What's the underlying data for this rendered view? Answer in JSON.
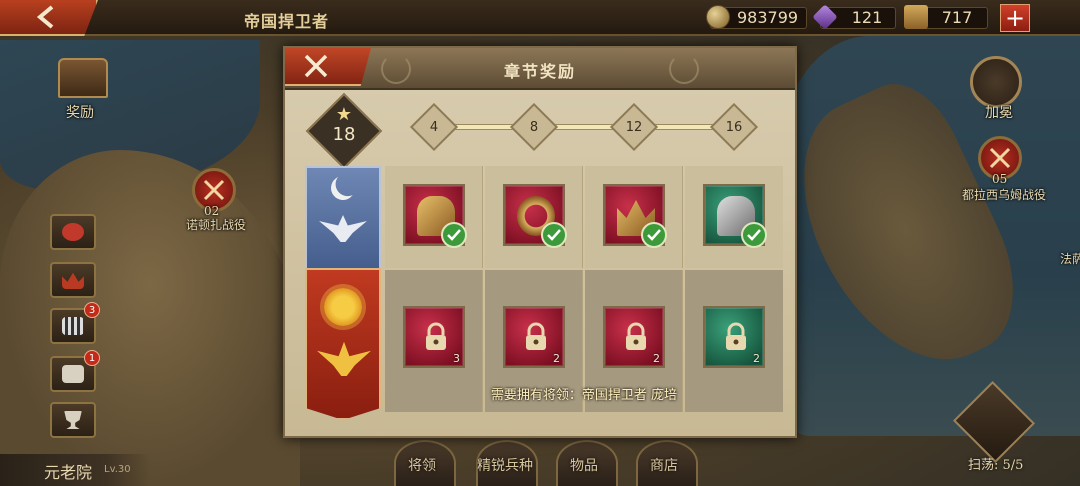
{
  "header": {
    "title": "帝国捍卫者",
    "resources": [
      {
        "name": "coins",
        "icon": "coin-icon",
        "value": "983799"
      },
      {
        "name": "gems",
        "icon": "gem-icon",
        "value": "121"
      },
      {
        "name": "supplies",
        "icon": "supply-chest-icon",
        "value": "717"
      }
    ],
    "add_label": "+"
  },
  "left_menu": {
    "rewards_label": "奖励",
    "buttons": [
      {
        "name": "bag",
        "badge": ""
      },
      {
        "name": "crown",
        "badge": ""
      },
      {
        "name": "film",
        "badge": "3"
      },
      {
        "name": "chest",
        "badge": "1"
      },
      {
        "name": "trophy",
        "badge": ""
      }
    ]
  },
  "map": {
    "battle_left": {
      "number": "02",
      "label": "诺顿扎战役"
    },
    "battle_right": {
      "number": "05",
      "label": "都拉西乌姆战役"
    },
    "right_edge_label": "法萨",
    "laurel_label": "加冕"
  },
  "senate": {
    "name": "元老院",
    "level": "Lv.30"
  },
  "bottom_nav": [
    "将领",
    "精锐兵种",
    "物品",
    "商店"
  ],
  "sweep": {
    "label": "扫荡: 5/5"
  },
  "modal": {
    "title": "章节奖励",
    "stars": "18",
    "star_glyph": "★",
    "milestones": [
      "4",
      "8",
      "12",
      "16"
    ],
    "row1_items": [
      {
        "name": "helmet",
        "color": "red",
        "claimed": true
      },
      {
        "name": "ring",
        "color": "red",
        "claimed": true
      },
      {
        "name": "crown",
        "color": "red",
        "claimed": true
      },
      {
        "name": "armor",
        "color": "green",
        "claimed": true
      }
    ],
    "row2_items": [
      {
        "name": "helmet",
        "color": "red",
        "count": "3"
      },
      {
        "name": "ring",
        "color": "red",
        "count": "2"
      },
      {
        "name": "crown",
        "color": "red",
        "count": "2"
      },
      {
        "name": "armor",
        "color": "green",
        "count": "2"
      }
    ],
    "requirement": "需要拥有将领：帝国捍卫者 庞培"
  }
}
